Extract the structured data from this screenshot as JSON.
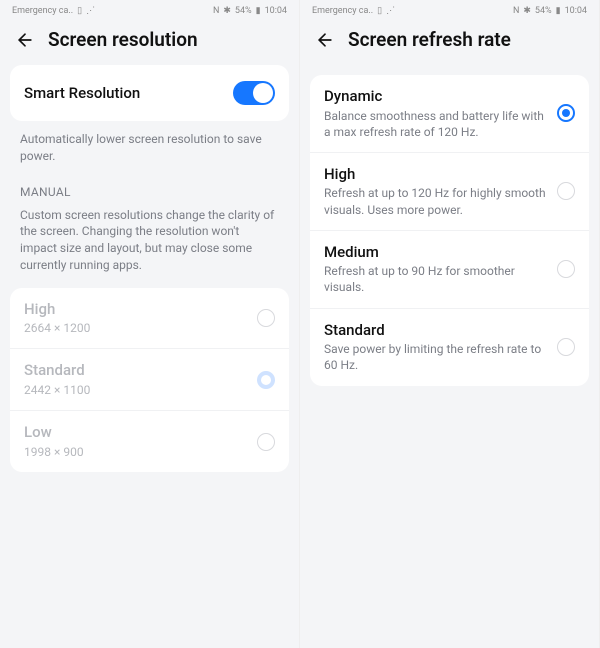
{
  "statusbar": {
    "left": "Emergency ca..",
    "nfc": "N",
    "bt": "✱",
    "battery": "54%",
    "time": "10:04"
  },
  "left": {
    "title": "Screen resolution",
    "smart": {
      "label": "Smart Resolution",
      "desc": "Automatically lower screen resolution to save power."
    },
    "manual": {
      "heading": "MANUAL",
      "desc": "Custom screen resolutions change the clarity of the screen. Changing the resolution won't impact size and layout, but may close some currently running apps."
    },
    "options": [
      {
        "title": "High",
        "sub": "2664 × 1200"
      },
      {
        "title": "Standard",
        "sub": "2442 × 1100"
      },
      {
        "title": "Low",
        "sub": "1998 × 900"
      }
    ]
  },
  "right": {
    "title": "Screen refresh rate",
    "options": [
      {
        "title": "Dynamic",
        "sub": "Balance smoothness and battery life with a max refresh rate of 120 Hz."
      },
      {
        "title": "High",
        "sub": "Refresh at up to 120 Hz for highly smooth visuals. Uses more power."
      },
      {
        "title": "Medium",
        "sub": "Refresh at up to 90 Hz for smoother visuals."
      },
      {
        "title": "Standard",
        "sub": "Save power by limiting the refresh rate to 60 Hz."
      }
    ]
  }
}
